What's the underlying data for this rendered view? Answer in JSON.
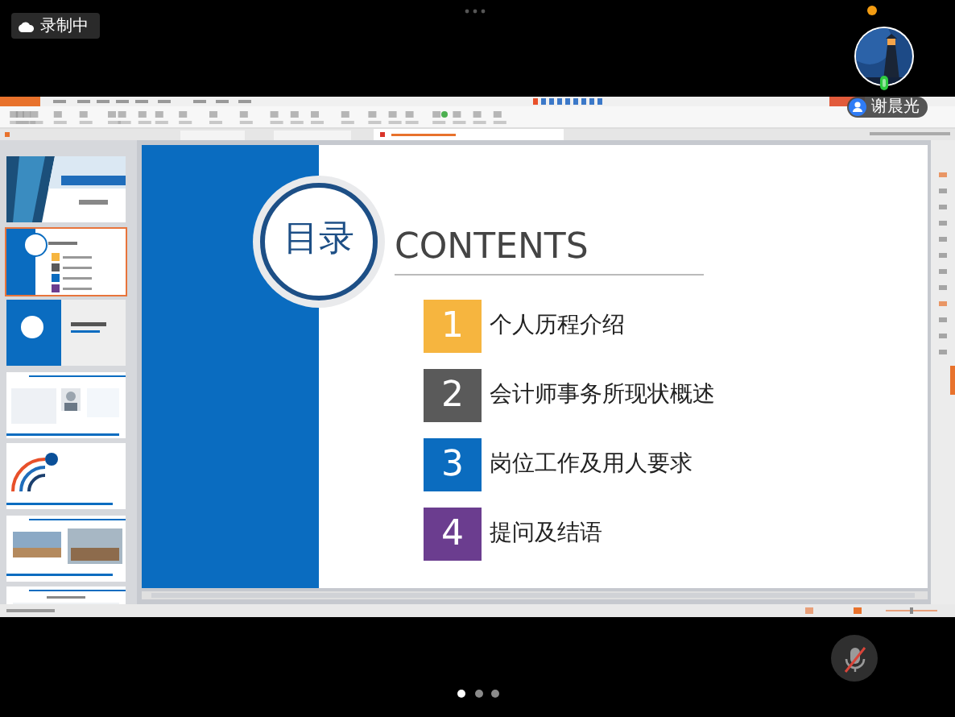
{
  "recording": {
    "label": "录制中"
  },
  "participant": {
    "name": "谢晨光",
    "mic_on": true
  },
  "slides": [
    {
      "kind": "cover",
      "selected": false
    },
    {
      "kind": "contents",
      "selected": true
    },
    {
      "kind": "section",
      "selected": false
    },
    {
      "kind": "profile",
      "selected": false
    },
    {
      "kind": "chart",
      "selected": false
    },
    {
      "kind": "photos",
      "selected": false
    },
    {
      "kind": "text",
      "selected": false
    }
  ],
  "slide": {
    "title": "目录",
    "heading": "CONTENTS",
    "items": [
      {
        "number": "1",
        "text": "个人历程介绍",
        "color": "#f6b53f"
      },
      {
        "number": "2",
        "text": "会计师事务所现状概述",
        "color": "#5a5a5a"
      },
      {
        "number": "3",
        "text": "岗位工作及用人要求",
        "color": "#0b6cbf"
      },
      {
        "number": "4",
        "text": "提问及结语",
        "color": "#6b3d8f"
      }
    ]
  },
  "self_mic": {
    "muted": true
  },
  "pages": [
    {
      "selected": true
    },
    {
      "selected": false
    },
    {
      "selected": false
    }
  ]
}
